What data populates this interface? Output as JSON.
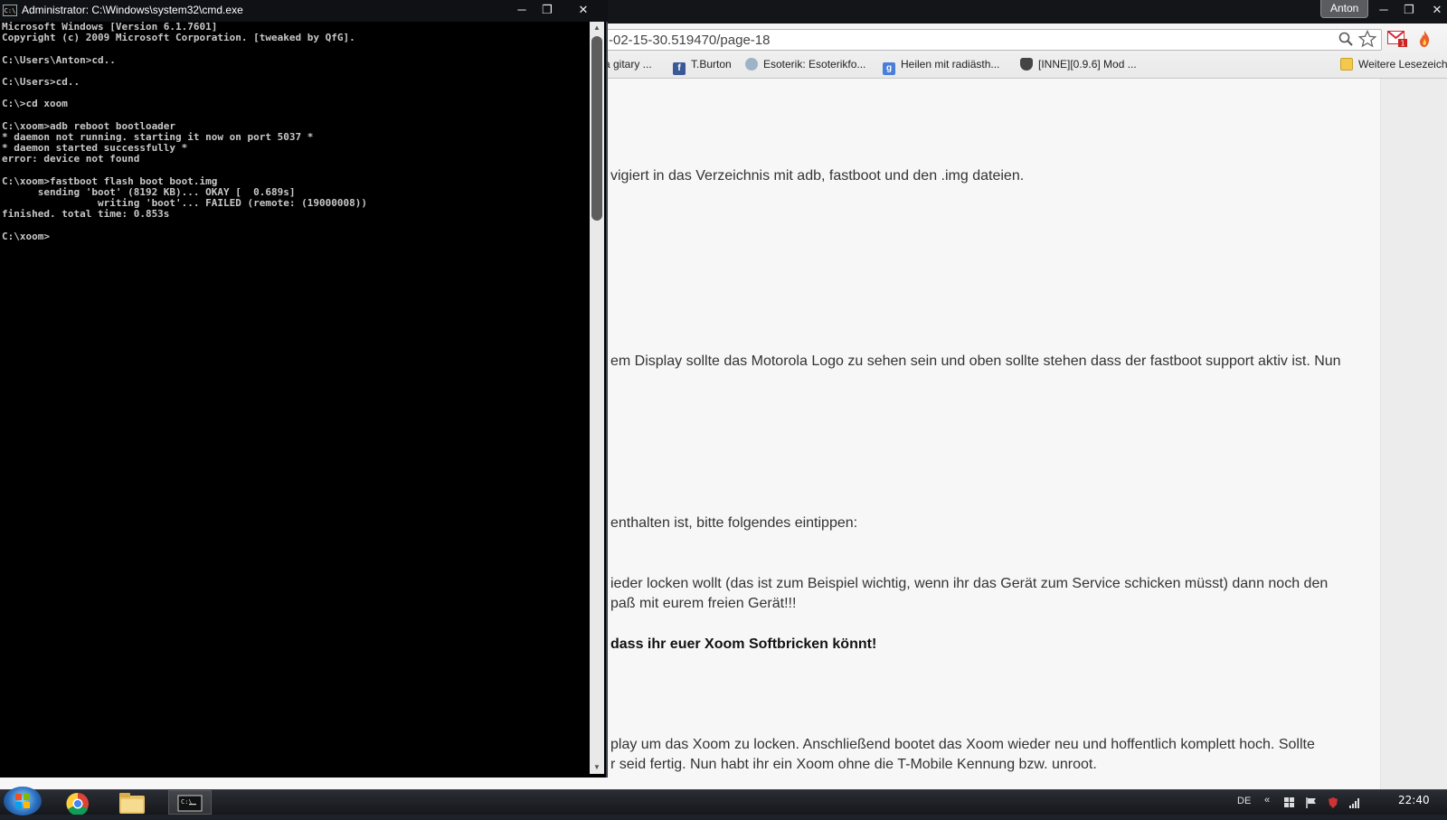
{
  "browser": {
    "user_badge": "Anton",
    "url": "-02-15-30.519470/page-18",
    "bookmarks": [
      {
        "label": "a gitary ...",
        "icon": "none"
      },
      {
        "label": "T.Burton",
        "icon": "facebook-icon"
      },
      {
        "label": "Esoterik: Esoterikfo...",
        "icon": "globe-icon"
      },
      {
        "label": "Heilen mit radiästh...",
        "icon": "google-icon"
      },
      {
        "label": "[INNE][0.9.6] Mod ...",
        "icon": "shield-icon"
      },
      {
        "label": "Weitere Lesezeich",
        "icon": "folder-icon"
      }
    ],
    "gmail_badge": "1",
    "page_lines": {
      "line1": "vigiert in das Verzeichnis mit adb, fastboot und den .img dateien.",
      "line2": "em Display sollte das Motorola Logo zu sehen sein und oben sollte stehen dass der fastboot support aktiv ist. Nun",
      "line3": "enthalten ist, bitte folgendes eintippen:",
      "line4": "ieder locken wollt (das ist zum Beispiel wichtig, wenn ihr das Gerät zum Service schicken müsst) dann noch den",
      "line5": "paß mit eurem freien Gerät!!!",
      "line6": "dass ihr euer Xoom Softbricken könnt!",
      "line7": "play um das Xoom zu locken. Anschließend bootet das Xoom wieder neu und hoffentlich komplett hoch. Sollte",
      "line8": "r seid fertig. Nun habt ihr ein Xoom ohne die T-Mobile Kennung bzw. unroot."
    }
  },
  "cmd": {
    "title": "Administrator: C:\\Windows\\system32\\cmd.exe",
    "icon_text": "C:\\",
    "console": "Microsoft Windows [Version 6.1.7601]\nCopyright (c) 2009 Microsoft Corporation. [tweaked by QfG].\n\nC:\\Users\\Anton>cd..\n\nC:\\Users>cd..\n\nC:\\>cd xoom\n\nC:\\xoom>adb reboot bootloader\n* daemon not running. starting it now on port 5037 *\n* daemon started successfully *\nerror: device not found\n\nC:\\xoom>fastboot flash boot boot.img\n      sending 'boot' (8192 KB)... OKAY [  0.689s]\n                writing 'boot'... FAILED (remote: (19000008))\nfinished. total time: 0.853s\n\nC:\\xoom>"
  },
  "taskbar": {
    "language": "DE",
    "clock": "22:40",
    "apps": [
      "chrome",
      "explorer",
      "cmd"
    ]
  }
}
